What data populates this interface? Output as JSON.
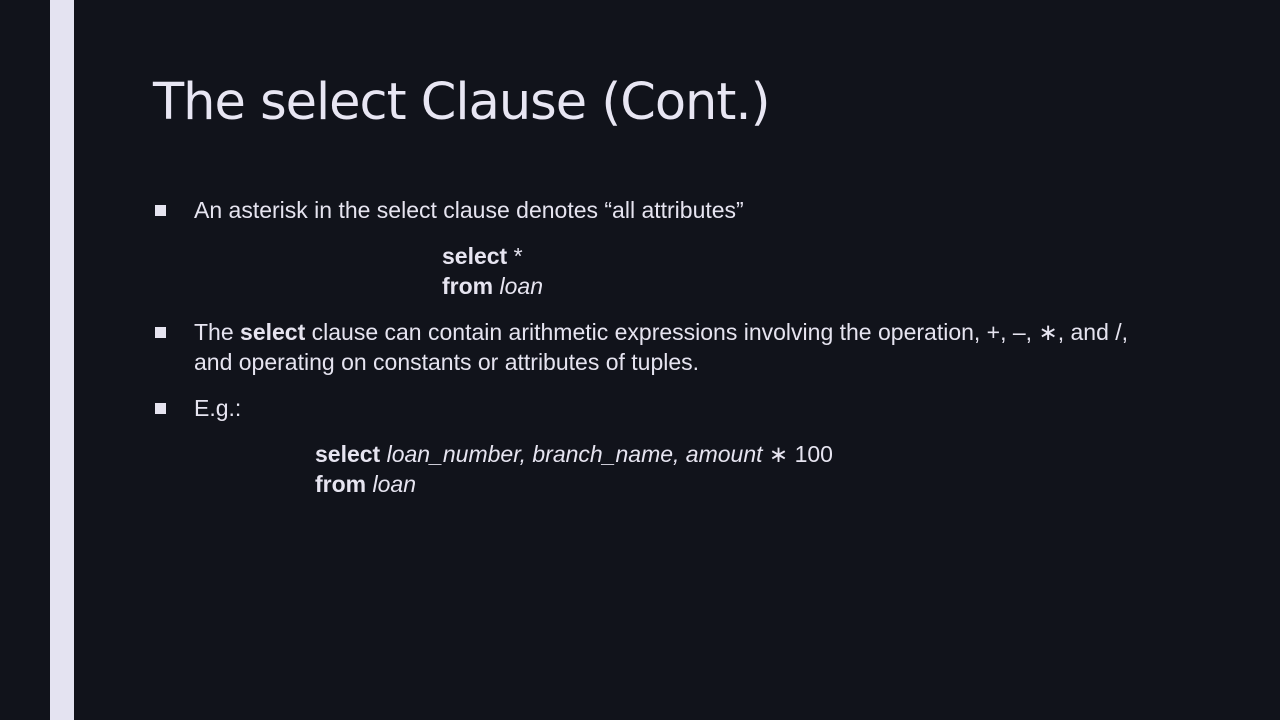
{
  "slide": {
    "title": "The select Clause (Cont.)",
    "bullets": [
      {
        "text": "An asterisk in the select clause denotes “all attributes”"
      },
      {
        "prefix": "The ",
        "keyword": "select",
        "text": " clause can contain arithmetic expressions involving the operation, +, –, ∗, and /, and operating on constants or attributes of tuples."
      },
      {
        "text": "E.g.:"
      }
    ],
    "example1": {
      "line1_keyword": "select",
      "line1_rest": " *",
      "line2_keyword": "from",
      "line2_rest": " loan"
    },
    "example2": {
      "line1_keyword": "select",
      "line1_italic": " loan_number, branch_name, amount",
      "line1_rest": " ∗ 100",
      "line2_keyword": "from",
      "line2_rest": " loan"
    }
  },
  "colors": {
    "background": "#11131b",
    "accent_bar": "#e4e3f1",
    "text": "#e6e4f0"
  }
}
